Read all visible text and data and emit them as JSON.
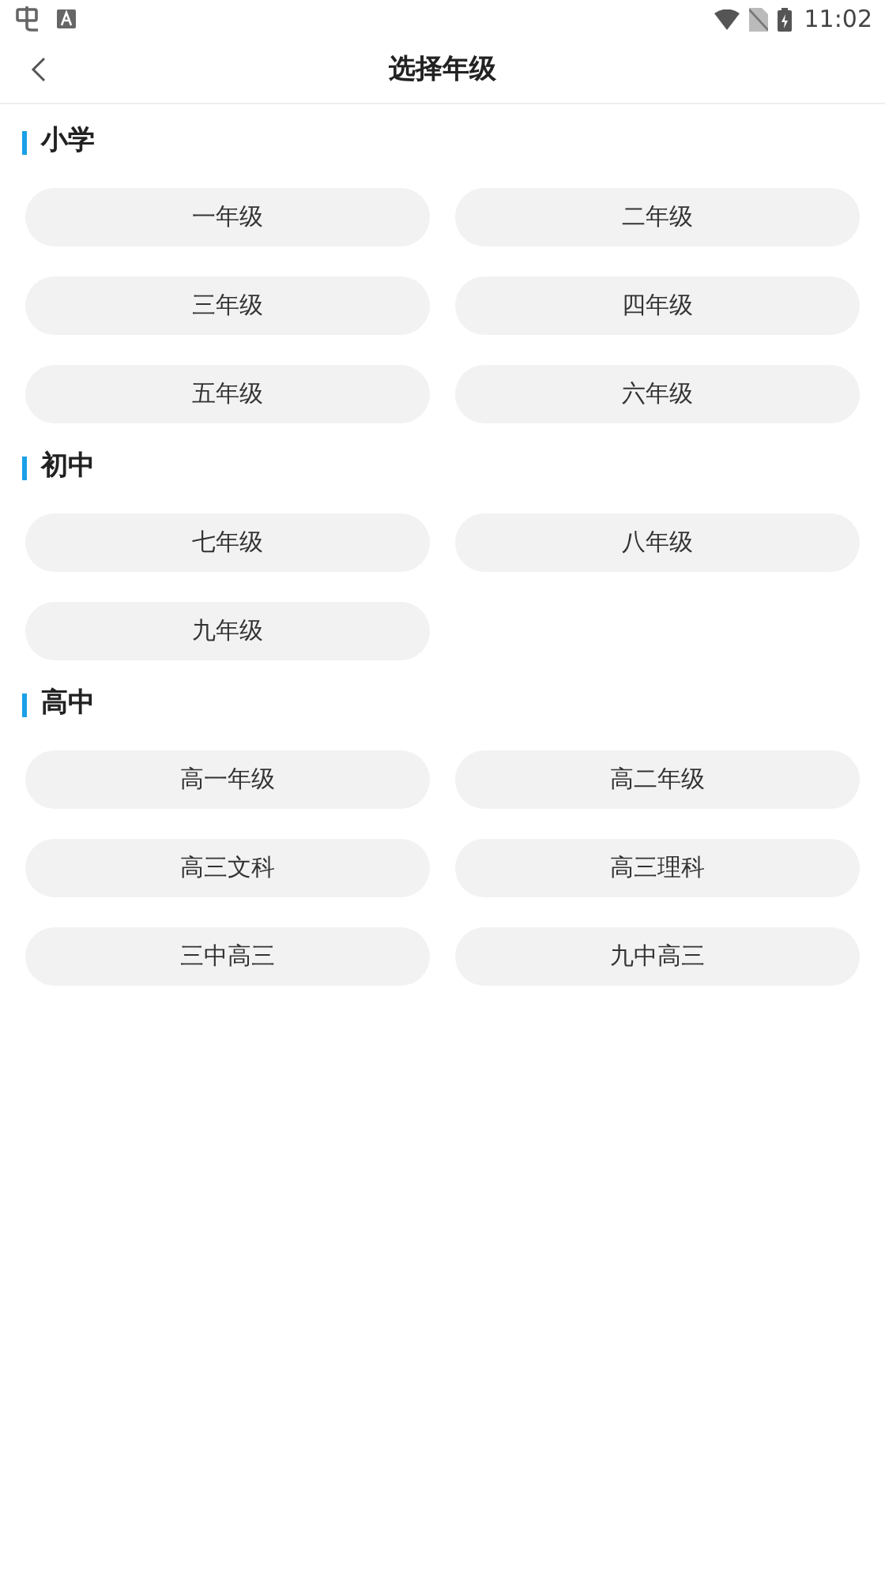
{
  "status_bar": {
    "time": "11:02"
  },
  "header": {
    "title": "选择年级"
  },
  "sections": [
    {
      "title": "小学",
      "grades": [
        "一年级",
        "二年级",
        "三年级",
        "四年级",
        "五年级",
        "六年级"
      ]
    },
    {
      "title": "初中",
      "grades": [
        "七年级",
        "八年级",
        "九年级"
      ]
    },
    {
      "title": "高中",
      "grades": [
        "高一年级",
        "高二年级",
        "高三文科",
        "高三理科",
        "三中高三",
        "九中高三"
      ]
    }
  ]
}
